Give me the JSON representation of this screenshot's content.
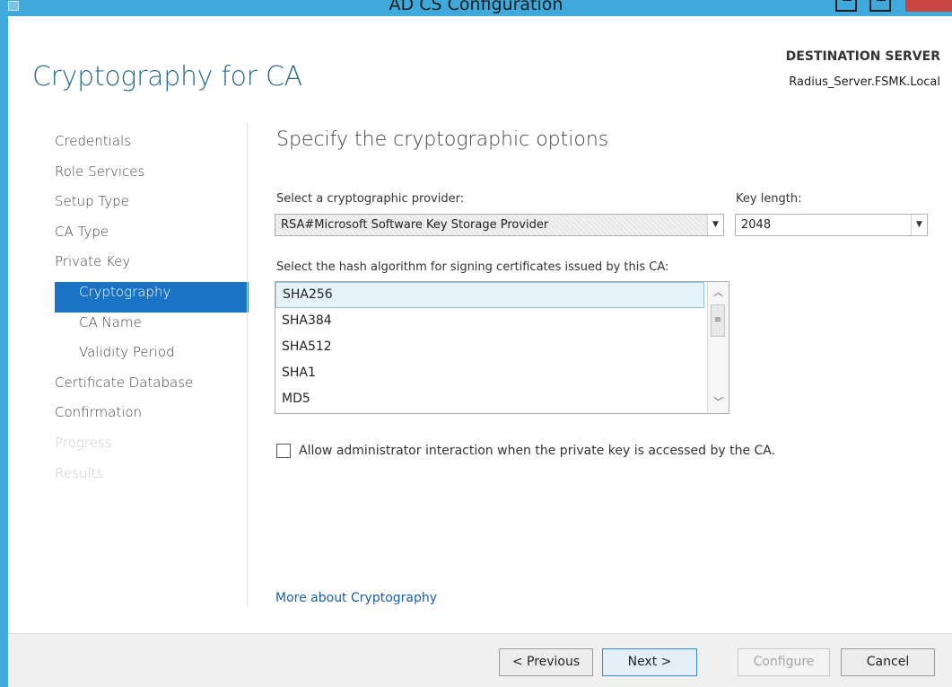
{
  "window": {
    "title": "AD CS Configuration"
  },
  "header": {
    "page_title": "Cryptography for CA",
    "destination_label": "DESTINATION SERVER",
    "destination_server": "Radius_Server.FSMK.Local"
  },
  "nav": {
    "items": [
      {
        "label": "Credentials",
        "state": "normal",
        "indent": false
      },
      {
        "label": "Role Services",
        "state": "normal",
        "indent": false
      },
      {
        "label": "Setup Type",
        "state": "normal",
        "indent": false
      },
      {
        "label": "CA Type",
        "state": "normal",
        "indent": false
      },
      {
        "label": "Private Key",
        "state": "normal",
        "indent": false
      },
      {
        "label": "Cryptography",
        "state": "active",
        "indent": true
      },
      {
        "label": "CA Name",
        "state": "normal",
        "indent": true
      },
      {
        "label": "Validity Period",
        "state": "normal",
        "indent": true
      },
      {
        "label": "Certificate Database",
        "state": "normal",
        "indent": false
      },
      {
        "label": "Confirmation",
        "state": "normal",
        "indent": false
      },
      {
        "label": "Progress",
        "state": "disabled",
        "indent": false
      },
      {
        "label": "Results",
        "state": "disabled",
        "indent": false
      }
    ]
  },
  "content": {
    "heading": "Specify the cryptographic options",
    "provider_label": "Select a cryptographic provider:",
    "provider_value": "RSA#Microsoft Software Key Storage Provider",
    "keylength_label": "Key length:",
    "keylength_value": "2048",
    "hash_label": "Select the hash algorithm for signing certificates issued by this CA:",
    "hash_options": [
      "SHA256",
      "SHA384",
      "SHA512",
      "SHA1",
      "MD5"
    ],
    "hash_selected": "SHA256",
    "admin_interaction_label": "Allow administrator interaction when the private key is accessed by the CA.",
    "admin_interaction_checked": false,
    "more_link": "More about Cryptography"
  },
  "footer": {
    "previous_label": "< Previous",
    "next_label": "Next >",
    "configure_label": "Configure",
    "cancel_label": "Cancel"
  },
  "colors": {
    "accent": "#1a73c4",
    "title_bar": "#3fa9dc",
    "page_title": "#2b6b86",
    "link": "#1a5fa8"
  },
  "icons": {
    "dropdown": "chevron-down-icon",
    "scroll_up": "chevron-up-icon",
    "scroll_down": "chevron-down-icon",
    "scroll_grip": "grip-icon"
  }
}
